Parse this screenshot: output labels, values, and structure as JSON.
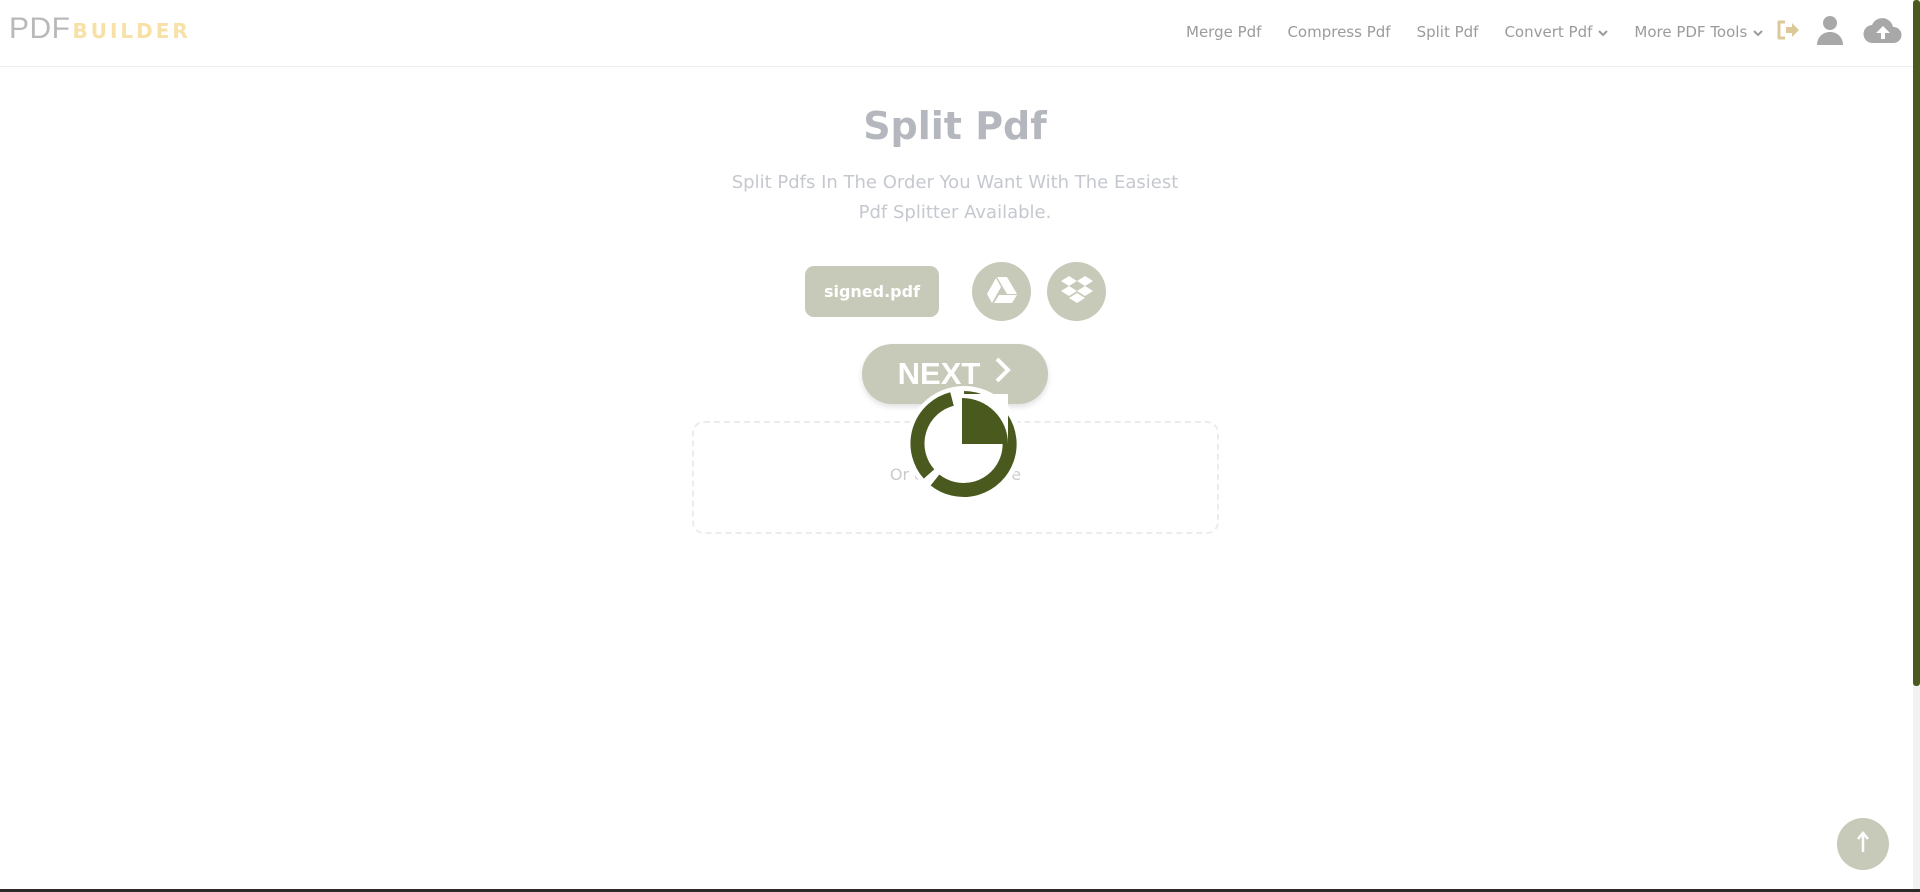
{
  "header": {
    "logo": {
      "main": "PDF",
      "sub": "BUILDER"
    },
    "nav": [
      {
        "label": "Merge Pdf",
        "dropdown": false
      },
      {
        "label": "Compress Pdf",
        "dropdown": false
      },
      {
        "label": "Split Pdf",
        "dropdown": false
      },
      {
        "label": "Convert Pdf",
        "dropdown": true
      },
      {
        "label": "More PDF Tools",
        "dropdown": true
      }
    ],
    "icons": [
      "logout-icon",
      "user-icon",
      "cloud-upload-icon"
    ]
  },
  "main": {
    "title": "Split Pdf",
    "subtitle": "Split Pdfs In The Order You Want With The Easiest Pdf Splitter Available.",
    "file_name": "signed.pdf",
    "next_label": "NEXT",
    "drop_text": "Or drop file here"
  },
  "colors": {
    "accent": "#c7cab8",
    "spinner": "#4a5a1f",
    "logo_sub": "#f8e1a6"
  }
}
